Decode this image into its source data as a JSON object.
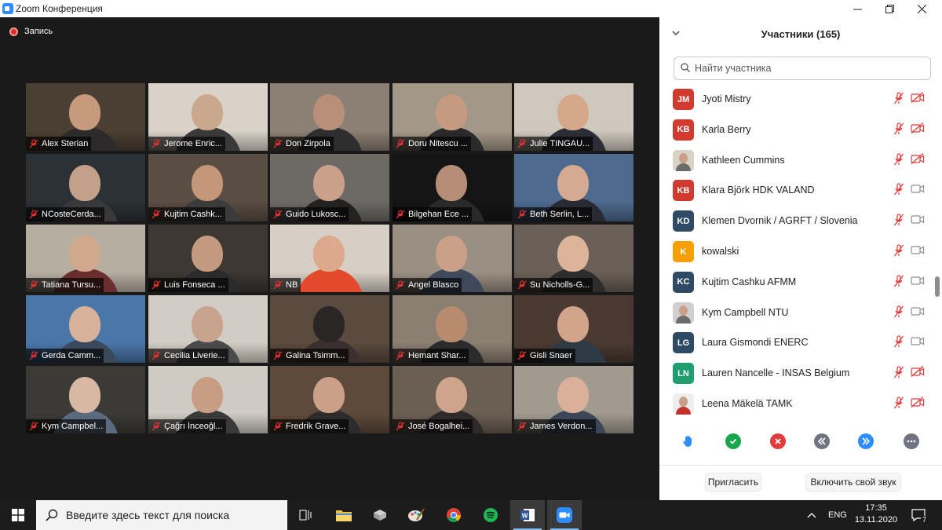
{
  "window": {
    "title": "Zoom Конференция",
    "minimize": "—",
    "maximize": "❐",
    "close": "✕"
  },
  "recording": {
    "label": "Запись"
  },
  "gallery": [
    {
      "name": "Alex Sterian",
      "bg": "#4b3f33",
      "skin": "#c59a7d",
      "shirt": "#2c2a2a"
    },
    {
      "name": "Jerome Enric...",
      "bg": "#d8d2c8",
      "skin": "#c9a88d",
      "shirt": "#3a3a3a"
    },
    {
      "name": "Don Zirpola",
      "bg": "#8c7f73",
      "skin": "#b8907a",
      "shirt": "#2e2e2e"
    },
    {
      "name": "Doru Nitescu ...",
      "bg": "#a39887",
      "skin": "#c49a80",
      "shirt": "#2a2a2a"
    },
    {
      "name": "Julie TINGAU...",
      "bg": "#cfc8bd",
      "skin": "#d6a88a",
      "shirt": "#2d2d35"
    },
    {
      "name": "NCosteCerda...",
      "bg": "#2b3134",
      "skin": "#c2a08a",
      "shirt": "#39393b"
    },
    {
      "name": "Kujtim Cashk...",
      "bg": "#5a4e44",
      "skin": "#c4977a",
      "shirt": "#3b3b3b"
    },
    {
      "name": "Guido Lukosc...",
      "bg": "#6d6a66",
      "skin": "#caa08a",
      "shirt": "#222222"
    },
    {
      "name": "Bilgehan Ece ...",
      "bg": "#151515",
      "skin": "#b68e78",
      "shirt": "#2a2a2a"
    },
    {
      "name": "Beth Serlin, L...",
      "bg": "#4e6a8e",
      "skin": "#d4ab92",
      "shirt": "#2a2a33"
    },
    {
      "name": "Tatiana Tursu...",
      "bg": "#b6aea1",
      "skin": "#d0a88c",
      "shirt": "#6a2e2e"
    },
    {
      "name": "Luis Fonseca ...",
      "bg": "#3e3834",
      "skin": "#c29a80",
      "shirt": "#2b2b2b"
    },
    {
      "name": "NB",
      "bg": "#d7cfc6",
      "skin": "#dca98c",
      "shirt": "#e24a2b"
    },
    {
      "name": "Angel Blasco",
      "bg": "#9a8f83",
      "skin": "#caa088",
      "shirt": "#3e4a5c"
    },
    {
      "name": "Su Nicholls-G...",
      "bg": "#6a6058",
      "skin": "#dcb49a",
      "shirt": "#2d2d2d"
    },
    {
      "name": "Gerda Camm...",
      "bg": "#4a76a8",
      "skin": "#d8b19a",
      "shirt": "#3a4a5a"
    },
    {
      "name": "Cecilia Liverie...",
      "bg": "#d2cdc4",
      "skin": "#c8a38e",
      "shirt": "#4a4a4a"
    },
    {
      "name": "Galina Tsimm...",
      "bg": "#5b4a3e",
      "skin": "#2a2626",
      "shirt": "#3a3030"
    },
    {
      "name": "Hemant Shar...",
      "bg": "#8b7f72",
      "skin": "#b98b6e",
      "shirt": "#2b2b2b"
    },
    {
      "name": "Gisli Snaer",
      "bg": "#4a3a32",
      "skin": "#d2a489",
      "shirt": "#2e3b44"
    },
    {
      "name": "Kym Campbel...",
      "bg": "#3c3a36",
      "skin": "#d8b8a2",
      "shirt": "#5b6b7d"
    },
    {
      "name": "Çağrı İnceoğl...",
      "bg": "#cfcac4",
      "skin": "#c79d84",
      "shirt": "#3a3a3a"
    },
    {
      "name": "Fredrik Grave...",
      "bg": "#5e4a3a",
      "skin": "#caa088",
      "shirt": "#2c2c2c"
    },
    {
      "name": "José Bogalhei...",
      "bg": "#6b5f54",
      "skin": "#cfa48c",
      "shirt": "#2e2a2a"
    },
    {
      "name": "James Verdon...",
      "bg": "#a19a8e",
      "skin": "#d9b09a",
      "shirt": "#3c4656"
    }
  ],
  "participants": {
    "title": "Участники (165)",
    "search_placeholder": "Найти участника",
    "list": [
      {
        "initials": "JM",
        "name": "Jyoti Mistry",
        "avatar_color": "#d13b2f",
        "photo": false,
        "video_on": false
      },
      {
        "initials": "KB",
        "name": "Karla Berry",
        "avatar_color": "#d13b2f",
        "photo": false,
        "video_on": false
      },
      {
        "initials": "",
        "name": "Kathleen Cummins",
        "avatar_color": "#d9d2c6",
        "photo": true,
        "video_on": false
      },
      {
        "initials": "KB",
        "name": "Klara Björk HDK VALAND",
        "avatar_color": "#d13b2f",
        "photo": false,
        "video_on": true
      },
      {
        "initials": "KD",
        "name": "Klemen Dvornik / AGRFT / Slovenia",
        "avatar_color": "#2f4a64",
        "photo": false,
        "video_on": true
      },
      {
        "initials": "K",
        "name": "kowalski",
        "avatar_color": "#f5a000",
        "photo": false,
        "video_on": true
      },
      {
        "initials": "KC",
        "name": "Kujtim Cashku AFMM",
        "avatar_color": "#2f4a64",
        "photo": false,
        "video_on": true
      },
      {
        "initials": "",
        "name": "Kym Campbell NTU",
        "avatar_color": "#d0d0d0",
        "photo": true,
        "video_on": true
      },
      {
        "initials": "LG",
        "name": "Laura Gismondi ENERC",
        "avatar_color": "#2f4a64",
        "photo": false,
        "video_on": true
      },
      {
        "initials": "LN",
        "name": "Lauren Nancelle - INSAS Belgium",
        "avatar_color": "#1f9e6e",
        "photo": false,
        "video_on": false
      },
      {
        "initials": "",
        "name": "Leena Mäkelä TAMK",
        "avatar_color": "#eeeeee",
        "photo": true,
        "video_on": false
      }
    ],
    "reactions": [
      "raise-hand",
      "yes",
      "no",
      "slower",
      "faster",
      "more"
    ],
    "invite_label": "Пригласить",
    "unmute_label": "Включить свой звук"
  },
  "taskbar": {
    "search_placeholder": "Введите здесь текст для поиска",
    "lang": "ENG",
    "time": "17:35",
    "date": "13.11.2020",
    "notifications": "7"
  }
}
